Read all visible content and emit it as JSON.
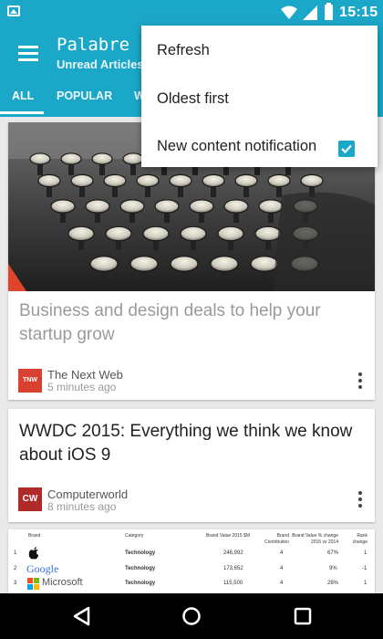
{
  "status_bar": {
    "time": "15:15"
  },
  "app": {
    "title": "Palabre",
    "subtitle": "Unread Articles"
  },
  "tabs": [
    {
      "label": "ALL"
    },
    {
      "label": "POPULAR"
    },
    {
      "label": "W"
    }
  ],
  "menu": {
    "items": [
      {
        "label": "Refresh"
      },
      {
        "label": "Oldest first"
      },
      {
        "label": "New content notification",
        "checked": true
      }
    ]
  },
  "articles": [
    {
      "title": "Business and design deals to help your startup grow",
      "source": "The Next Web",
      "time": "5 minutes ago",
      "logo_text": "TNW"
    },
    {
      "title": "WWDC 2015: Everything we think we know about iOS 9",
      "source": "Computerworld",
      "time": "8 minutes ago",
      "logo_text": "CW"
    }
  ],
  "table_preview": {
    "headers": [
      "Brand",
      "Category",
      "Brand Value 2015 $M",
      "Brand Contribution",
      "Brand Value % change 2015 vs 2014",
      "Rank change"
    ],
    "rows": [
      {
        "rank": "1",
        "brand": "",
        "category": "Technology",
        "value": "246,992",
        "contribution": "4",
        "change": "67%",
        "rank_change": "1"
      },
      {
        "rank": "2",
        "brand": "Google",
        "category": "Technology",
        "value": "173,652",
        "contribution": "4",
        "change": "9%",
        "rank_change": "-1"
      },
      {
        "rank": "3",
        "brand": "Microsoft",
        "category": "Technology",
        "value": "115,500",
        "contribution": "4",
        "change": "28%",
        "rank_change": "1"
      }
    ]
  },
  "colors": {
    "primary": "#1ba7c7",
    "checkbox": "#1ba7c7"
  },
  "icons": {
    "menu": "hamburger-icon",
    "more": "more-vert-icon",
    "back": "back-icon",
    "home": "home-icon",
    "recents": "recents-icon"
  }
}
